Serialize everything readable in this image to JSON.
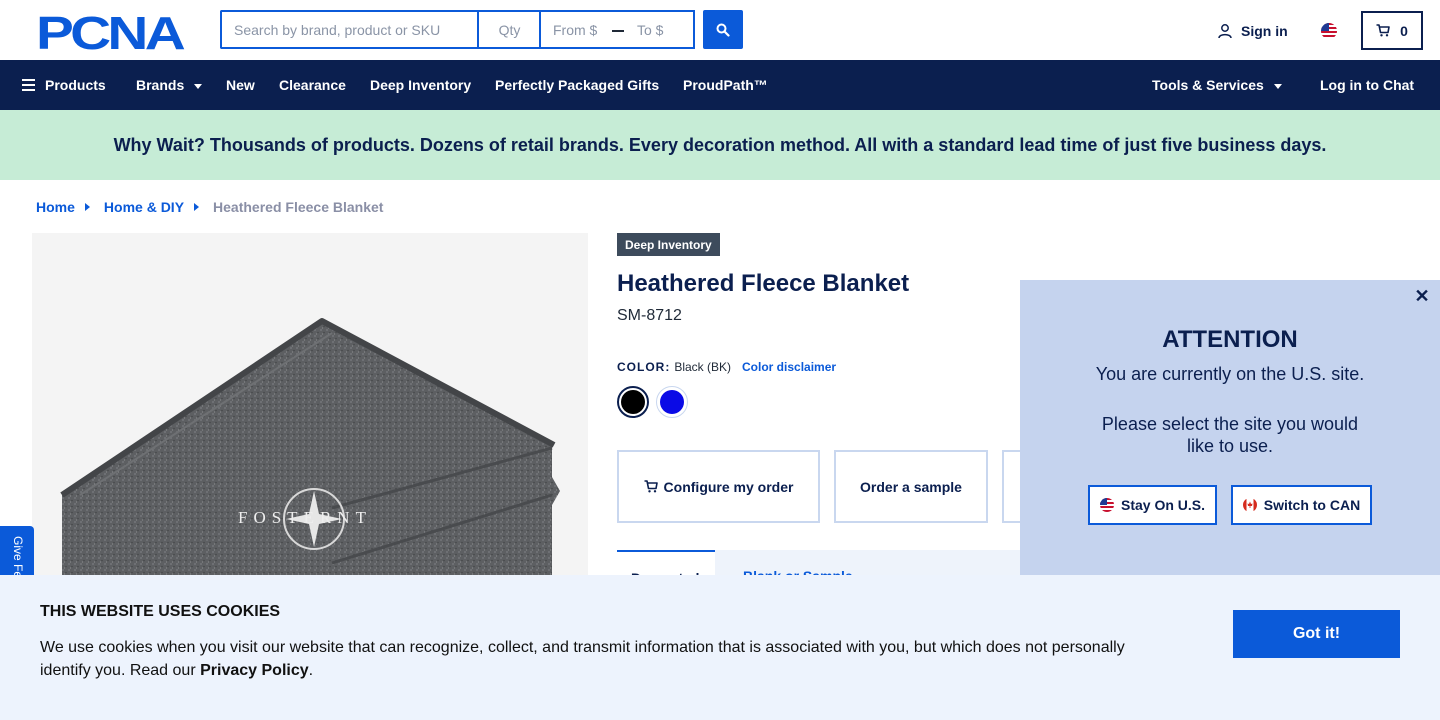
{
  "header": {
    "logo_text": "PCNA",
    "search_placeholder": "Search by brand, product or SKU",
    "qty_placeholder": "Qty",
    "from_placeholder": "From $",
    "to_placeholder": "To $",
    "signin_label": "Sign in",
    "cart_count": "0"
  },
  "nav": {
    "products": "Products",
    "brands": "Brands",
    "new": "New",
    "clearance": "Clearance",
    "deep_inventory": "Deep Inventory",
    "gifts": "Perfectly Packaged Gifts",
    "proudpath": "ProudPath™",
    "tools": "Tools & Services",
    "chat": "Log in to Chat"
  },
  "promo": "Why Wait? Thousands of products. Dozens of retail brands. Every decoration method. All with a standard lead time of just five business days.",
  "breadcrumb": {
    "home": "Home",
    "category": "Home & DIY",
    "current": "Heathered Fleece Blanket"
  },
  "product": {
    "badge": "Deep Inventory",
    "title": "Heathered Fleece Blanket",
    "sku": "SM-8712",
    "color_label": "COLOR:",
    "color_value": "Black (BK)",
    "color_disclaimer": "Color disclaimer",
    "swatches": [
      {
        "name": "Black",
        "color": "#000000",
        "selected": true
      },
      {
        "name": "Royal Blue",
        "color": "#0a0ae6",
        "selected": false
      }
    ],
    "configure_label": "Configure my order",
    "sample_label": "Order a sample",
    "image_logo_text": "FOSTERNT",
    "tabs": [
      "Decorated",
      "Blank or Sample"
    ]
  },
  "feedback_label": "Give Feedback",
  "modal": {
    "heading": "ATTENTION",
    "line1": "You are currently on the U.S. site.",
    "line2": "Please select the site you would like to use.",
    "stay_label": "Stay On U.S.",
    "switch_label": "Switch to CAN"
  },
  "cookies": {
    "title": "THIS WEBSITE USES COOKIES",
    "body": "We use cookies when you visit our website that can recognize, collect, and transmit information that is associated with you, but which does not personally identify you. Read our",
    "link": "Privacy Policy",
    "end": ".",
    "button": "Got it!"
  },
  "colors": {
    "navy": "#0b1f4f",
    "blue": "#0b5ad9",
    "promo_bg": "#c6ecd6",
    "modal_bg": "#c5d3ee",
    "cookie_bg": "#edf3fd"
  }
}
